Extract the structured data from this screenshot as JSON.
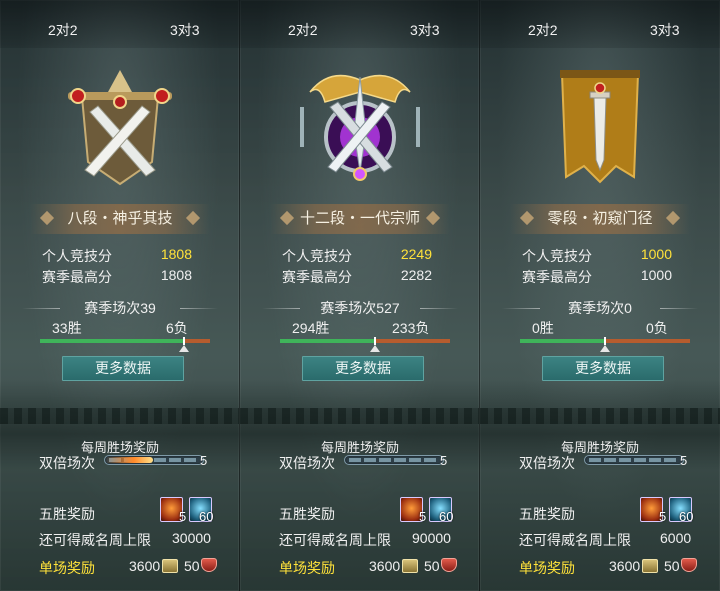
{
  "colors": {
    "highlight_score": "#ffe23a",
    "button_bg": "#2f7374",
    "win_bar": "#3fb45a",
    "loss_bar": "#b65c2e",
    "single_reward_label": "#ffe23a"
  },
  "panels": [
    {
      "tabs": {
        "left": "2对2",
        "right": "3对3"
      },
      "emblem_icon": "crossed-swords-crest-icon",
      "rank": "八段・神乎其技",
      "personal_score_label": "个人竞技分",
      "personal_score": "1808",
      "season_best_label": "赛季最高分",
      "season_best": "1808",
      "season_matches": "赛季场次39",
      "wins": "33胜",
      "losses": "6负",
      "win_ratio": 0.846,
      "more_button": "更多数据",
      "weekly_title": "每周胜场奖励",
      "double_label": "双倍场次",
      "double_value": "5",
      "double_progress": 0.5,
      "five_win_label": "五胜奖励",
      "item1_count": "5",
      "item2_count": "60",
      "cap_label": "还可得威名周上限",
      "cap_value": "30000",
      "single_label": "单场奖励",
      "single_value1": "3600",
      "single_value2": "50"
    },
    {
      "tabs": {
        "left": "2对2",
        "right": "3对3"
      },
      "emblem_icon": "winged-purple-gem-crest-icon",
      "rank": "十二段・一代宗师",
      "personal_score_label": "个人竞技分",
      "personal_score": "2249",
      "season_best_label": "赛季最高分",
      "season_best": "2282",
      "season_matches": "赛季场次527",
      "wins": "294胜",
      "losses": "233负",
      "win_ratio": 0.558,
      "more_button": "更多数据",
      "weekly_title": "每周胜场奖励",
      "double_label": "双倍场次",
      "double_value": "5",
      "double_progress": 0,
      "five_win_label": "五胜奖励",
      "item1_count": "5",
      "item2_count": "60",
      "cap_label": "还可得威名周上限",
      "cap_value": "90000",
      "single_label": "单场奖励",
      "single_value1": "3600",
      "single_value2": "50"
    },
    {
      "tabs": {
        "left": "2对2",
        "right": "3对3"
      },
      "emblem_icon": "sword-banner-crest-icon",
      "rank": "零段・初窥门径",
      "personal_score_label": "个人竞技分",
      "personal_score": "1000",
      "season_best_label": "赛季最高分",
      "season_best": "1000",
      "season_matches": "赛季场次0",
      "wins": "0胜",
      "losses": "0负",
      "win_ratio": 0.5,
      "more_button": "更多数据",
      "weekly_title": "每周胜场奖励",
      "double_label": "双倍场次",
      "double_value": "5",
      "double_progress": 0,
      "five_win_label": "五胜奖励",
      "item1_count": "5",
      "item2_count": "60",
      "cap_label": "还可得威名周上限",
      "cap_value": "6000",
      "single_label": "单场奖励",
      "single_value1": "3600",
      "single_value2": "50"
    }
  ]
}
